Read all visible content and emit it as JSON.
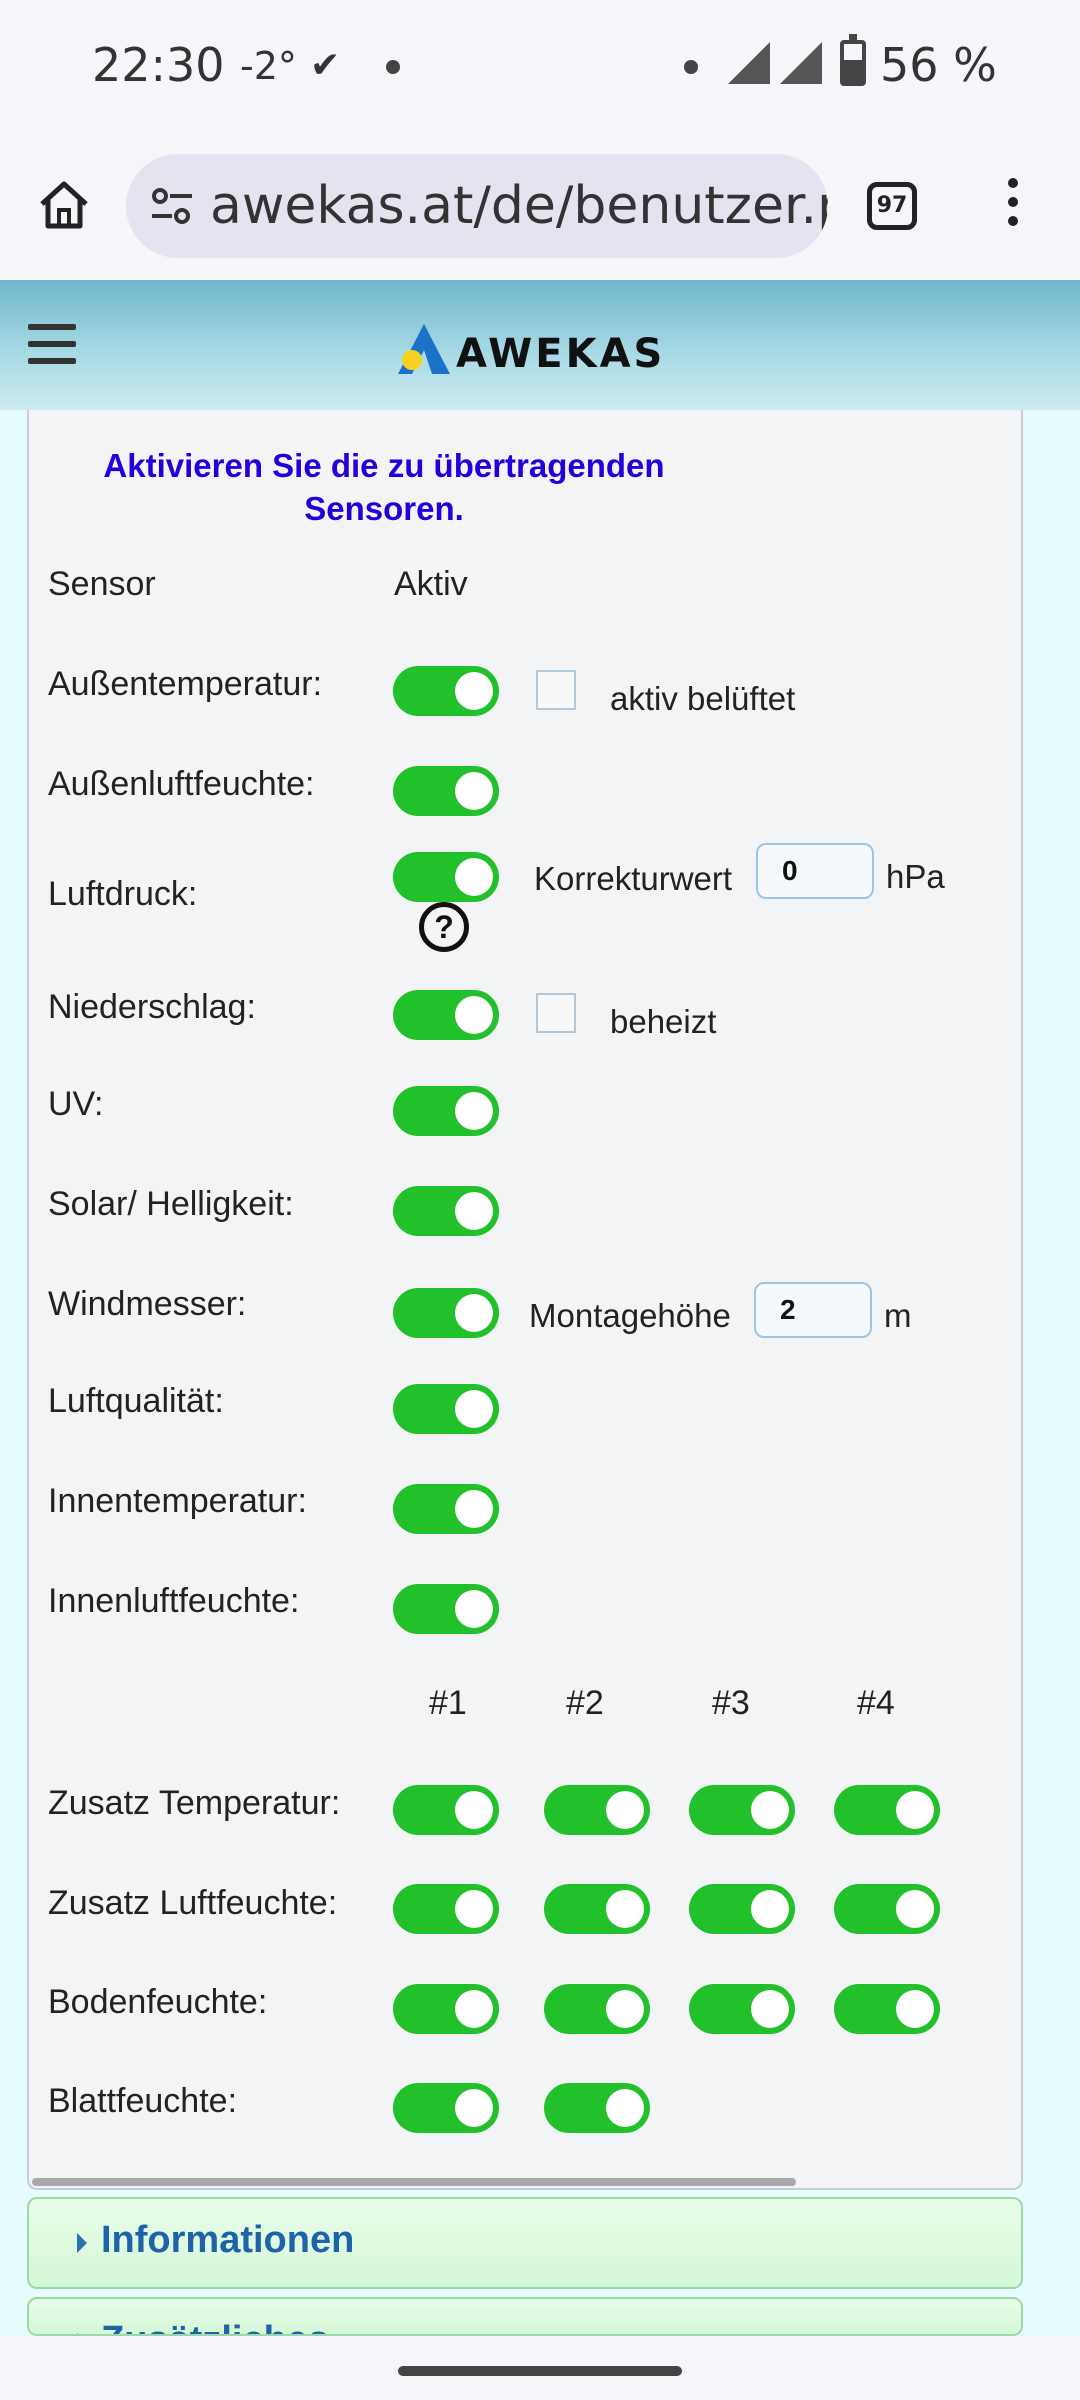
{
  "status_bar": {
    "time": "22:30",
    "weather": "-2°",
    "battery_percent": "56 %",
    "battery_level": 0.56
  },
  "browser": {
    "url": "awekas.at/de/benutzer.pl",
    "tab_count": "97",
    "icons": [
      "home-icon",
      "site-settings-icon",
      "tabs-icon",
      "more-menu-icon"
    ]
  },
  "site": {
    "logo_text": "AWEKAS",
    "colors": {
      "toggle_on": "#22c02a",
      "heading": "#2200dd",
      "accordion_text": "#1e63a8"
    }
  },
  "sensors_form": {
    "intro": "Aktivieren Sie die zu übertragenden Sensoren.",
    "header_sensor": "Sensor",
    "header_active": "Aktiv",
    "rows": [
      {
        "label": "Außentemperatur:",
        "active": true,
        "extra_checkbox_label": "aktiv belüftet",
        "extra_checked": false
      },
      {
        "label": "Außenluftfeuchte:",
        "active": true
      },
      {
        "label": "Luftdruck:",
        "active": true,
        "correction_label": "Korrekturwert",
        "correction_value": "0",
        "correction_unit": "hPa",
        "help": "?"
      },
      {
        "label": "Niederschlag:",
        "active": true,
        "extra_checkbox_label": "beheizt",
        "extra_checked": false
      },
      {
        "label": "UV:",
        "active": true
      },
      {
        "label": "Solar/ Helligkeit:",
        "active": true
      },
      {
        "label": "Windmesser:",
        "active": true,
        "height_label": "Montagehöhe",
        "height_value": "2",
        "height_unit": "m"
      },
      {
        "label": "Luftqualität:",
        "active": true
      },
      {
        "label": "Innentemperatur:",
        "active": true
      },
      {
        "label": "Innenluftfeuchte:",
        "active": true
      }
    ],
    "extra_headers": [
      "#1",
      "#2",
      "#3",
      "#4"
    ],
    "extra_rows": [
      {
        "label": "Zusatz Temperatur:",
        "states": [
          true,
          true,
          true,
          true
        ]
      },
      {
        "label": "Zusatz Luftfeuchte:",
        "states": [
          true,
          true,
          true,
          true
        ]
      },
      {
        "label": "Bodenfeuchte:",
        "states": [
          true,
          true,
          true,
          true
        ]
      },
      {
        "label": "Blattfeuchte:",
        "states": [
          true,
          true
        ]
      }
    ]
  },
  "accordions": [
    {
      "label": "Informationen"
    },
    {
      "label": "Zusätzliches"
    }
  ]
}
